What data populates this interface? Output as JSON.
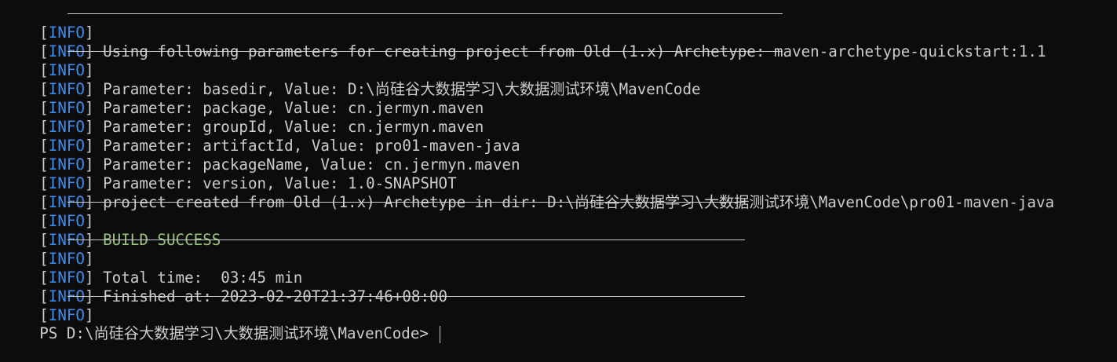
{
  "terminal": {
    "log_prefix_open": "[",
    "log_level": "INFO",
    "log_prefix_close": "]",
    "lines": [
      {
        "text": "",
        "rule": true
      },
      {
        "text": "Using following parameters for creating project from Old (1.x) Archetype: maven-archetype-quickstart:1.1",
        "rule": false
      },
      {
        "text": "",
        "rule": true
      },
      {
        "text": "Parameter: basedir, Value: D:\\尚硅谷大数据学习\\大数据测试环境\\MavenCode",
        "rule": false
      },
      {
        "text": "Parameter: package, Value: cn.jermyn.maven",
        "rule": false
      },
      {
        "text": "Parameter: groupId, Value: cn.jermyn.maven",
        "rule": false
      },
      {
        "text": "Parameter: artifactId, Value: pro01-maven-java",
        "rule": false
      },
      {
        "text": "Parameter: packageName, Value: cn.jermyn.maven",
        "rule": false
      },
      {
        "text": "Parameter: version, Value: 1.0-SNAPSHOT",
        "rule": false
      },
      {
        "text": "project created from Old (1.x) Archetype in dir: D:\\尚硅谷大数据学习\\大数据测试环境\\MavenCode\\pro01-maven-java",
        "rule": false
      },
      {
        "text": "",
        "rule": true
      },
      {
        "text": "BUILD SUCCESS",
        "rule": false
      },
      {
        "text": "",
        "rule": true
      },
      {
        "text": "Total time:  03:45 min",
        "rule": false
      },
      {
        "text": "Finished at: 2023-02-20T21:37:46+08:00",
        "rule": false
      },
      {
        "text": "",
        "rule": true
      }
    ],
    "prompt": "PS D:\\尚硅谷大数据学习\\大数据测试环境\\MavenCode>",
    "colors": {
      "background": "#0c0c0c",
      "foreground": "#cccccc",
      "info_tag": "#3b8eea",
      "success": "#98c379"
    }
  }
}
